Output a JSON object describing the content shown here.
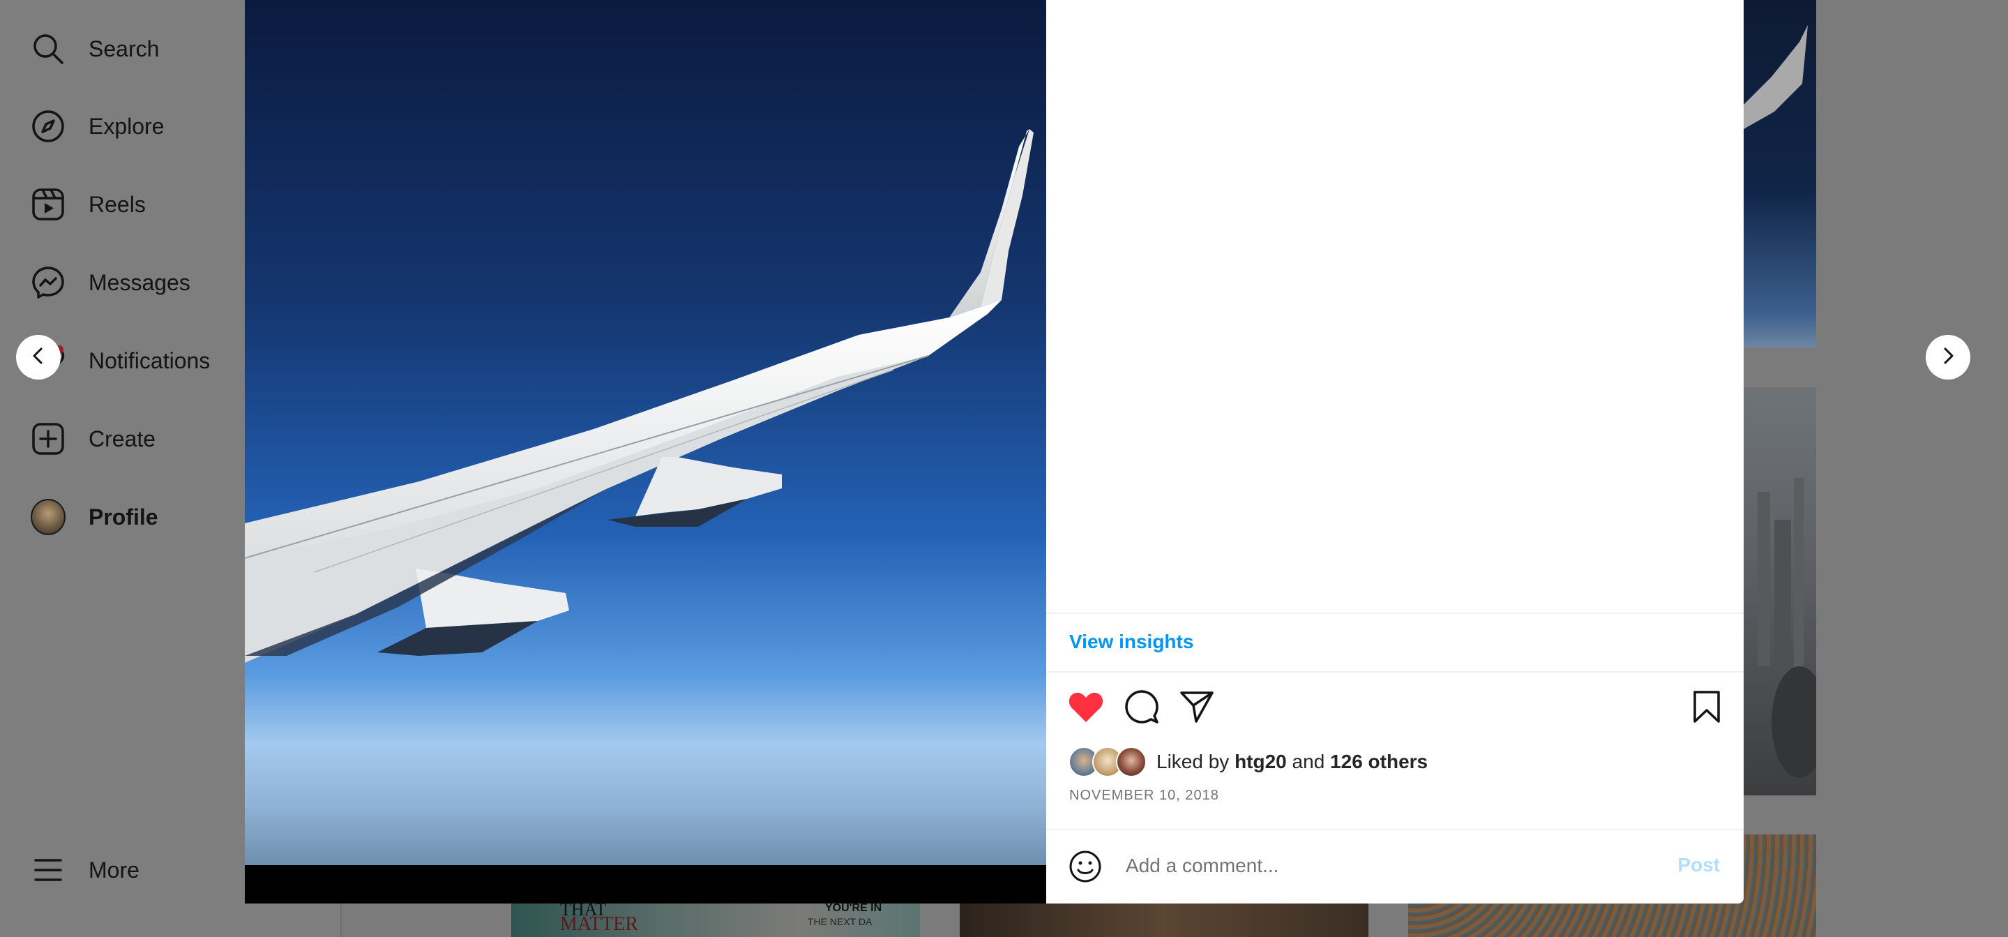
{
  "sidebar": {
    "items": [
      {
        "label": "Search",
        "icon": "search-icon"
      },
      {
        "label": "Explore",
        "icon": "compass-icon"
      },
      {
        "label": "Reels",
        "icon": "reels-icon"
      },
      {
        "label": "Messages",
        "icon": "messenger-icon"
      },
      {
        "label": "Notifications",
        "icon": "heart-icon"
      },
      {
        "label": "Create",
        "icon": "plus-square-icon"
      },
      {
        "label": "Profile",
        "icon": "avatar"
      }
    ],
    "more_label": "More"
  },
  "post": {
    "insights_label": "View insights",
    "liked_by_prefix": "Liked by",
    "liked_by_user": "htg20",
    "liked_by_and": "and",
    "liked_by_others": "126 others",
    "date": "NOVEMBER 10, 2018",
    "comment_placeholder": "Add a comment...",
    "post_label": "Post",
    "liked": true
  },
  "background_tiles": {
    "tile_text_1": "THAT",
    "tile_text_2": "MATTER",
    "tile_text_3": "YOU'RE IN",
    "tile_text_4": "THE NEXT DA"
  },
  "colors": {
    "accent": "#0095f6",
    "like": "#ff3040",
    "post_disabled": "#b2dffc"
  }
}
